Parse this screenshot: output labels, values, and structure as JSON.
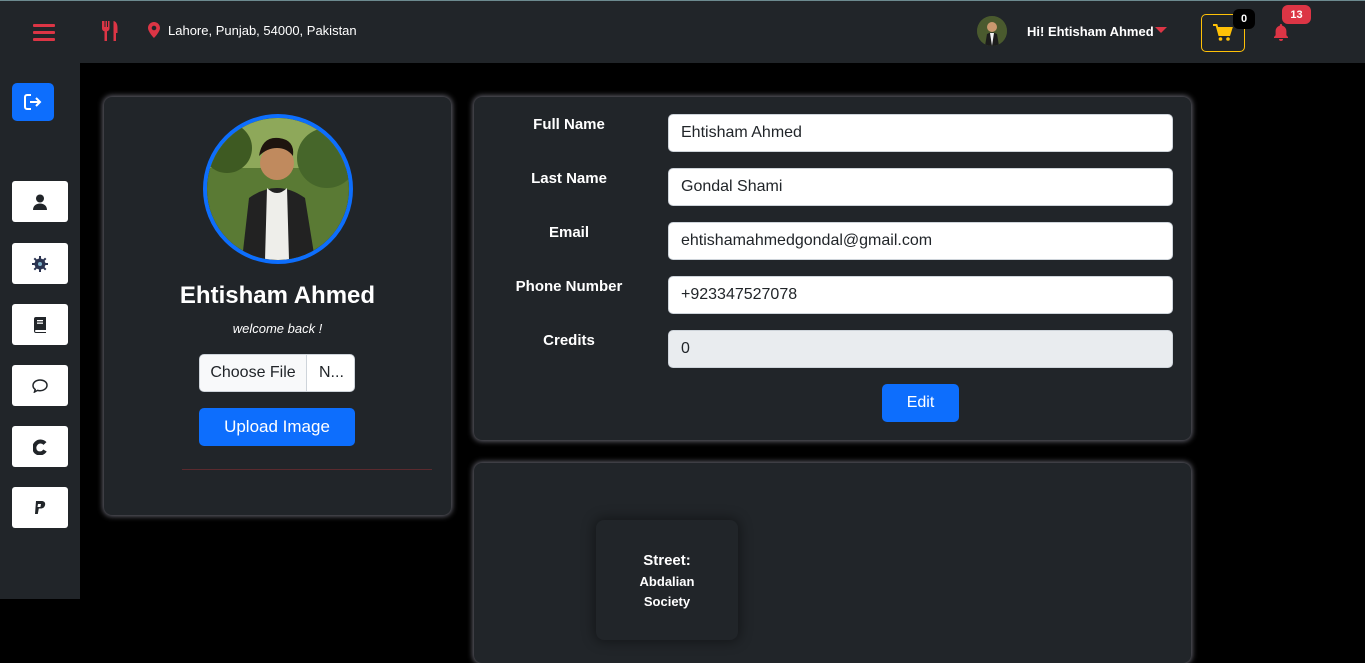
{
  "header": {
    "location": "Lahore, Punjab, 54000, Pakistan",
    "greeting": "Hi! Ehtisham Ahmed",
    "cart_count": "0",
    "notification_count": "13"
  },
  "sidebar": {
    "items": [
      {
        "icon": "logout-icon"
      },
      {
        "icon": "user-icon"
      },
      {
        "icon": "gear-icon"
      },
      {
        "icon": "book-icon"
      },
      {
        "icon": "chat-icon"
      },
      {
        "icon": "currency-icon"
      },
      {
        "icon": "paypal-icon"
      }
    ]
  },
  "profile": {
    "name": "Ehtisham Ahmed",
    "welcome": "welcome back !",
    "choose_file_label": "Choose File",
    "file_name": "N...",
    "upload_label": "Upload Image"
  },
  "form": {
    "full_name_label": "Full Name",
    "full_name_value": "Ehtisham Ahmed",
    "last_name_label": "Last Name",
    "last_name_value": "Gondal Shami",
    "email_label": "Email",
    "email_value": "ehtishamahmedgondal@gmail.com",
    "phone_label": "Phone Number",
    "phone_value": "+923347527078",
    "credits_label": "Credits",
    "credits_value": "0",
    "edit_label": "Edit"
  },
  "address": {
    "street_label": "Street:",
    "street_value": "Abdalian Society"
  },
  "colors": {
    "accent_red": "#dc3545",
    "primary_blue": "#0d6efd",
    "cart_yellow": "#ffc107",
    "panel_dark": "#212529"
  }
}
